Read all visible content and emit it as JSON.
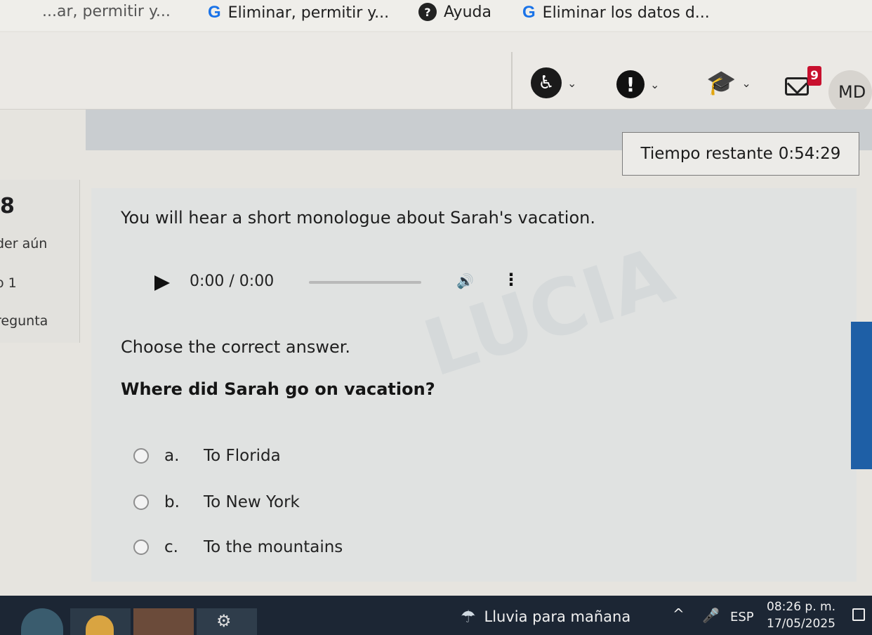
{
  "bookmarks": {
    "items": [
      {
        "label": "...ar, permitir y...",
        "icon": "google-icon"
      },
      {
        "label": "Eliminar, permitir y...",
        "icon": "google-icon"
      },
      {
        "label": "Ayuda",
        "icon": "help-icon"
      },
      {
        "label": "Eliminar los datos d...",
        "icon": "google-icon"
      }
    ],
    "google_glyph": "G",
    "help_glyph": "?"
  },
  "header": {
    "accessibility_glyph": "♿",
    "alert_glyph": "!",
    "mortarboard_glyph": "🎓",
    "chevron_glyph": "⌄",
    "messages_badge": "9",
    "user_initials": "MD"
  },
  "timer": {
    "label": "Tiempo restante",
    "value": "0:54:29"
  },
  "info": {
    "question_number": "8",
    "status_line": "der aún",
    "grade_line": "o 1",
    "flag_line": "regunta"
  },
  "question": {
    "intro": "You will hear a short monologue about Sarah's vacation.",
    "instruction": "Choose the correct answer.",
    "text": "Where did Sarah go on vacation?",
    "options": [
      {
        "letter": "a.",
        "text": "To Florida"
      },
      {
        "letter": "b.",
        "text": "To New York"
      },
      {
        "letter": "c.",
        "text": "To the mountains"
      }
    ]
  },
  "audio_player": {
    "time_display": "0:00 / 0:00",
    "progress": 0,
    "volume_glyph": "🔊",
    "more_glyph": "⋮"
  },
  "watermark": {
    "text": "LUCIA"
  },
  "taskbar": {
    "weather_glyph": "☂",
    "weather_text": "Lluvia para mañana",
    "tray_chevron_glyph": "^",
    "mic_glyph": "🎤",
    "language": "ESP",
    "time": "08:26 p. m.",
    "date": "17/05/2025"
  },
  "colors": {
    "badge": "#c8102e",
    "taskbar": "#1c2634",
    "accent_blue": "#1e5fa6"
  }
}
